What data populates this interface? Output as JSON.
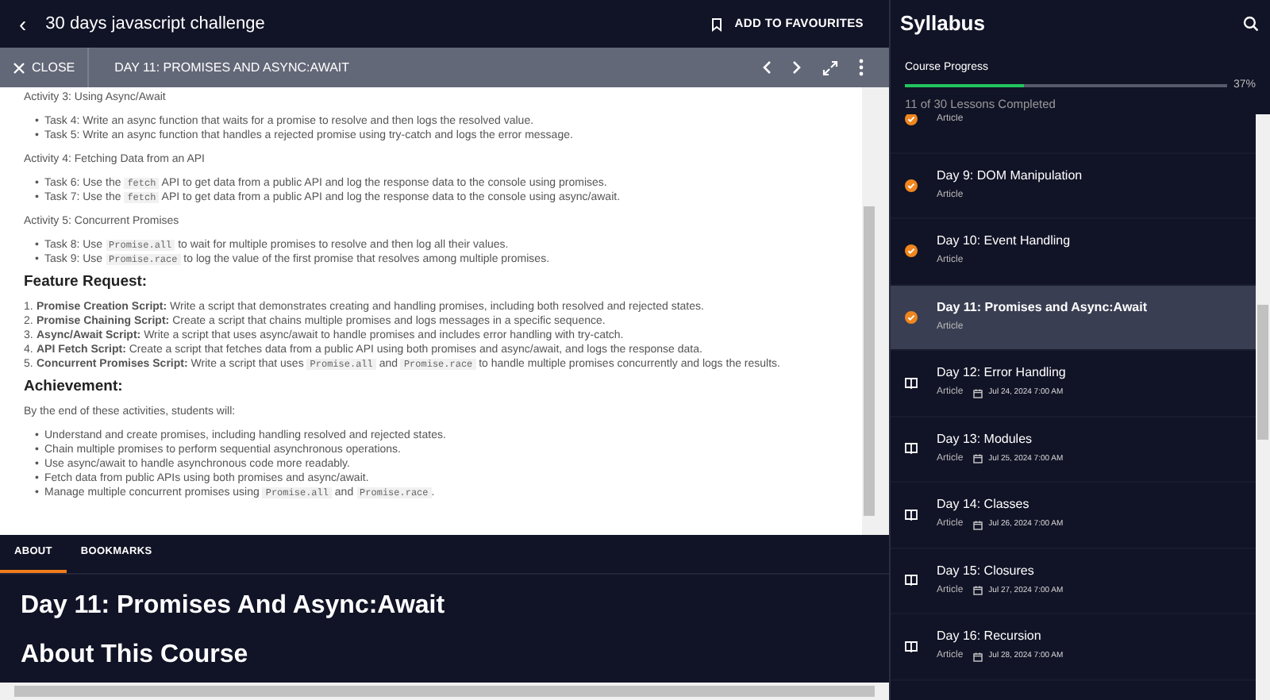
{
  "top_bar": {
    "back": "‹",
    "title": "30 days javascript challenge",
    "favourite": "ADD TO FAVOURITES"
  },
  "lesson_bar": {
    "close": "CLOSE",
    "title": "DAY 11: PROMISES AND ASYNC:AWAIT"
  },
  "content": [
    {
      "kind": "subheading",
      "text": "Activity 3: Using Async/Await"
    },
    {
      "kind": "bullets",
      "items": [
        [
          {
            "kind": "text",
            "text": "Task 4: Write an async function that waits for a promise to resolve and then logs the resolved value."
          }
        ],
        [
          {
            "kind": "text",
            "text": "Task 5: Write an async function that handles a rejected promise using try-catch and logs the error message."
          }
        ]
      ]
    },
    {
      "kind": "subheading",
      "text": "Activity 4: Fetching Data from an API"
    },
    {
      "kind": "bullets",
      "items": [
        [
          {
            "kind": "text",
            "text": "Task 6: Use the "
          },
          {
            "kind": "code",
            "text": "fetch"
          },
          {
            "kind": "text",
            "text": " API to get data from a public API and log the response data to the console using promises."
          }
        ],
        [
          {
            "kind": "text",
            "text": "Task 7: Use the "
          },
          {
            "kind": "code",
            "text": "fetch"
          },
          {
            "kind": "text",
            "text": " API to get data from a public API and log the response data to the console using async/await."
          }
        ]
      ]
    },
    {
      "kind": "subheading",
      "text": "Activity 5: Concurrent Promises"
    },
    {
      "kind": "bullets",
      "items": [
        [
          {
            "kind": "text",
            "text": "Task 8: Use "
          },
          {
            "kind": "code",
            "text": "Promise.all"
          },
          {
            "kind": "text",
            "text": " to wait for multiple promises to resolve and then log all their values."
          }
        ],
        [
          {
            "kind": "text",
            "text": "Task 9: Use "
          },
          {
            "kind": "code",
            "text": "Promise.race"
          },
          {
            "kind": "text",
            "text": " to log the value of the first promise that resolves among multiple promises."
          }
        ]
      ]
    },
    {
      "kind": "heading",
      "text": "Feature Request:"
    },
    {
      "kind": "numbered",
      "items": [
        {
          "number": "1.",
          "parts": [
            {
              "kind": "text",
              "text": "**Promise Creation Script:** Write a script that demonstrates creating and handling promises, including both resolved and rejected states."
            }
          ]
        },
        {
          "number": "2.",
          "parts": [
            {
              "kind": "text",
              "text": "**Promise Chaining Script:** Create a script that chains multiple promises and logs messages in a specific sequence."
            }
          ]
        },
        {
          "number": "3.",
          "parts": [
            {
              "kind": "text",
              "text": "**Async/Await Script:** Write a script that uses async/await to handle promises and includes error handling with try-catch."
            }
          ]
        },
        {
          "number": "4.",
          "parts": [
            {
              "kind": "text",
              "text": "**API Fetch Script:** Create a script that fetches data from a public API using both promises and async/await, and logs the response data."
            }
          ]
        },
        {
          "number": "5.",
          "parts": [
            {
              "kind": "text",
              "text": "**Concurrent Promises Script:** Write a script that uses "
            },
            {
              "kind": "code",
              "text": "Promise.all"
            },
            {
              "kind": "text",
              "text": " and "
            },
            {
              "kind": "code",
              "text": "Promise.race"
            },
            {
              "kind": "text",
              "text": " to handle multiple promises concurrently and logs the results."
            }
          ]
        }
      ]
    },
    {
      "kind": "heading",
      "text": "Achievement:"
    },
    {
      "kind": "paragraph",
      "text": "By the end of these activities, students will:"
    },
    {
      "kind": "bullets",
      "items": [
        [
          {
            "kind": "text",
            "text": "Understand and create promises, including handling resolved and rejected states."
          }
        ],
        [
          {
            "kind": "text",
            "text": "Chain multiple promises to perform sequential asynchronous operations."
          }
        ],
        [
          {
            "kind": "text",
            "text": "Use async/await to handle asynchronous code more readably."
          }
        ],
        [
          {
            "kind": "text",
            "text": "Fetch data from public APIs using both promises and async/await."
          }
        ],
        [
          {
            "kind": "text",
            "text": "Manage multiple concurrent promises using "
          },
          {
            "kind": "code",
            "text": "Promise.all"
          },
          {
            "kind": "text",
            "text": " and "
          },
          {
            "kind": "code",
            "text": "Promise.race"
          },
          {
            "kind": "text",
            "text": "."
          }
        ]
      ]
    }
  ],
  "bullet": "•",
  "tabs": [
    {
      "label": "ABOUT",
      "selected": true
    },
    {
      "label": "BOOKMARKS",
      "selected": false
    }
  ],
  "about": {
    "title": "Day 11: Promises And Async:Await",
    "section": "About This Course"
  },
  "sidebar": {
    "title": "Syllabus",
    "progress": {
      "label": "Course Progress",
      "level": 0.37,
      "percent": "37%",
      "summary": "11 of 30 Lessons Completed"
    },
    "lessons": [
      {
        "type": "Article",
        "completed": true,
        "selected": false
      },
      {
        "title": "Day 9: DOM Manipulation",
        "type": "Article",
        "completed": true,
        "selected": false
      },
      {
        "title": "Day 10: Event Handling",
        "type": "Article",
        "completed": true,
        "selected": false
      },
      {
        "title": "Day 11: Promises and Async:Await",
        "type": "Article",
        "completed": true,
        "selected": true
      },
      {
        "title": "Day 12: Error Handling",
        "type": "Article",
        "completed": false,
        "date": "Jul 24, 2024 7:00 AM",
        "selected": false
      },
      {
        "title": "Day 13: Modules",
        "type": "Article",
        "completed": false,
        "date": "Jul 25, 2024 7:00 AM",
        "selected": false
      },
      {
        "title": "Day 14: Classes",
        "type": "Article",
        "completed": false,
        "date": "Jul 26, 2024 7:00 AM",
        "selected": false
      },
      {
        "title": "Day 15: Closures",
        "type": "Article",
        "completed": false,
        "date": "Jul 27, 2024 7:00 AM",
        "selected": false
      },
      {
        "title": "Day 16: Recursion",
        "type": "Article",
        "completed": false,
        "date": "Jul 28, 2024 7:00 AM",
        "selected": false
      }
    ]
  }
}
